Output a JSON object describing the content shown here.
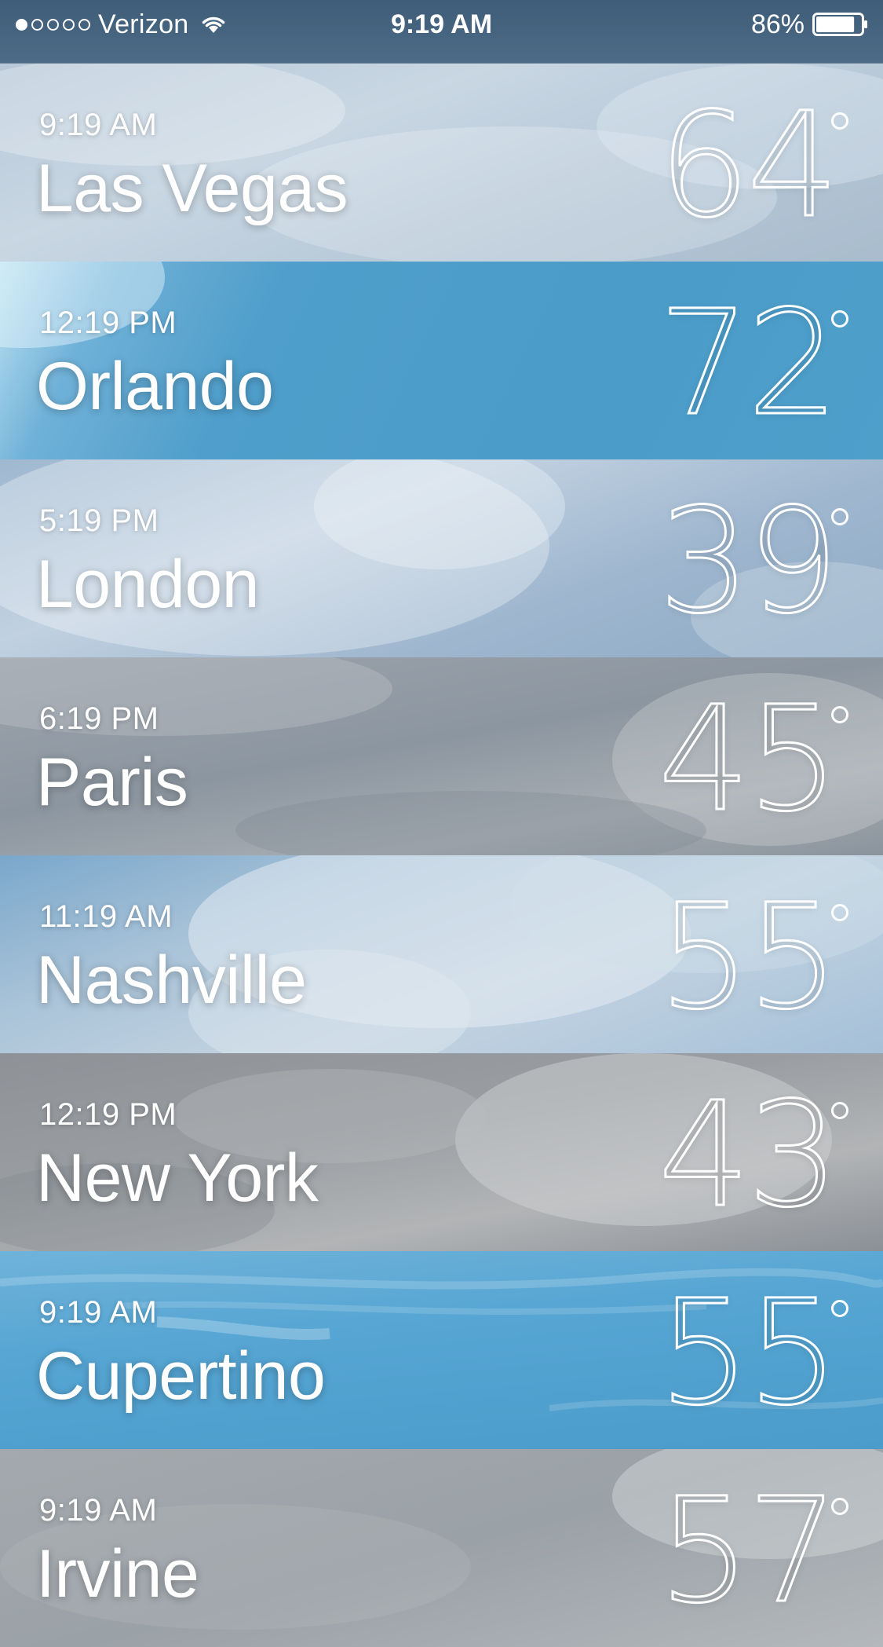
{
  "status_bar": {
    "carrier": "Verizon",
    "signal_bars_filled": 1,
    "signal_bars_total": 5,
    "time": "9:19 AM",
    "battery_percent": "86%",
    "battery_level": 0.86
  },
  "cities": [
    {
      "local_time": "9:19 AM",
      "name": "Las Vegas",
      "temperature": "64",
      "condition_bg": "cloudy-light"
    },
    {
      "local_time": "12:19 PM",
      "name": "Orlando",
      "temperature": "72",
      "condition_bg": "clear-blue"
    },
    {
      "local_time": "5:19 PM",
      "name": "London",
      "temperature": "39",
      "condition_bg": "cloudy-bright"
    },
    {
      "local_time": "6:19 PM",
      "name": "Paris",
      "temperature": "45",
      "condition_bg": "overcast"
    },
    {
      "local_time": "11:19 AM",
      "name": "Nashville",
      "temperature": "55",
      "condition_bg": "partly"
    },
    {
      "local_time": "12:19 PM",
      "name": "New York",
      "temperature": "43",
      "condition_bg": "overcast-dark"
    },
    {
      "local_time": "9:19 AM",
      "name": "Cupertino",
      "temperature": "55",
      "condition_bg": "sunny-streaks"
    },
    {
      "local_time": "9:19 AM",
      "name": "Irvine",
      "temperature": "57",
      "condition_bg": "overcast-grey"
    }
  ],
  "icons": {
    "wifi": "wifi-icon",
    "battery": "battery-icon",
    "signal": "signal-strength-icon"
  },
  "colors": {
    "text": "#ffffff",
    "status_bar": "#46647f"
  }
}
